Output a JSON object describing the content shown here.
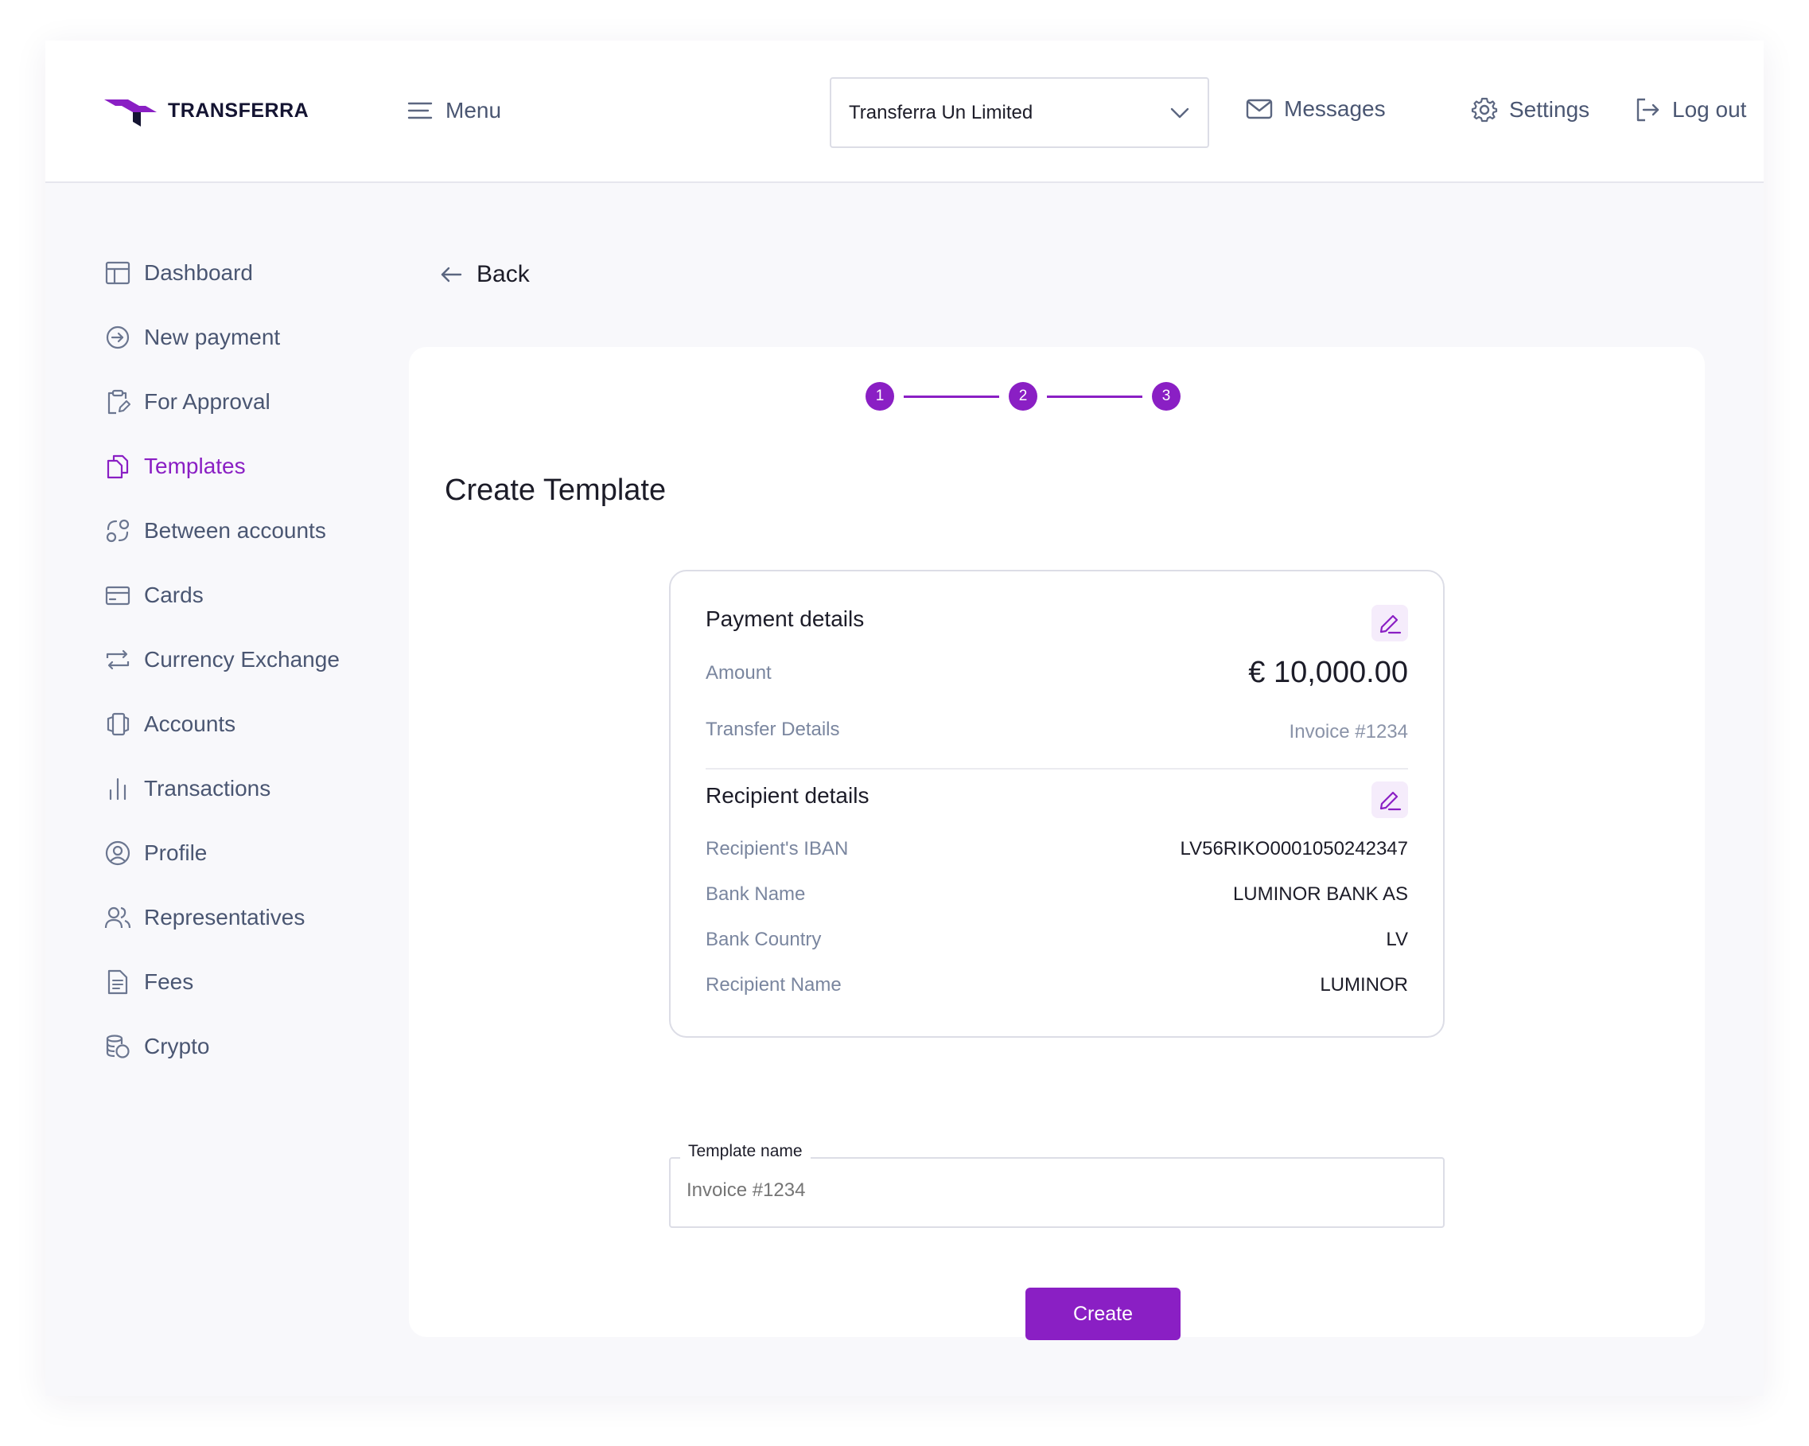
{
  "brand": {
    "name": "TRANSFERRA",
    "accent": "#8a1fc4",
    "dark": "#141432"
  },
  "header": {
    "menu_label": "Menu",
    "company": "Transferra Un Limited",
    "messages_label": "Messages",
    "settings_label": "Settings",
    "logout_label": "Log out"
  },
  "sidebar": {
    "items": [
      {
        "label": "Dashboard",
        "icon": "dashboard-icon"
      },
      {
        "label": "New payment",
        "icon": "arrow-circle-icon"
      },
      {
        "label": "For Approval",
        "icon": "clipboard-edit-icon"
      },
      {
        "label": "Templates",
        "icon": "templates-icon",
        "active": true
      },
      {
        "label": "Between accounts",
        "icon": "between-accounts-icon"
      },
      {
        "label": "Cards",
        "icon": "card-icon"
      },
      {
        "label": "Currency Exchange",
        "icon": "exchange-icon"
      },
      {
        "label": "Accounts",
        "icon": "accounts-icon"
      },
      {
        "label": "Transactions",
        "icon": "bar-chart-icon"
      },
      {
        "label": "Profile",
        "icon": "user-circle-icon"
      },
      {
        "label": "Representatives",
        "icon": "users-icon"
      },
      {
        "label": "Fees",
        "icon": "document-icon"
      },
      {
        "label": "Crypto",
        "icon": "coins-icon"
      }
    ]
  },
  "back_label": "Back",
  "stepper": {
    "steps": [
      "1",
      "2",
      "3"
    ]
  },
  "page_title": "Create Template",
  "payment": {
    "heading": "Payment details",
    "amount_label": "Amount",
    "amount_value": "€ 10,000.00",
    "transfer_label": "Transfer Details",
    "transfer_value": "Invoice #1234"
  },
  "recipient": {
    "heading": "Recipient details",
    "iban_label": "Recipient's IBAN",
    "iban_value": "LV56RIKO0001050242347",
    "bank_name_label": "Bank Name",
    "bank_name_value": "LUMINOR BANK AS",
    "bank_country_label": "Bank Country",
    "bank_country_value": "LV",
    "name_label": "Recipient Name",
    "name_value": "LUMINOR"
  },
  "template_field": {
    "label": "Template name",
    "placeholder": "Invoice #1234",
    "value": ""
  },
  "create_label": "Create"
}
